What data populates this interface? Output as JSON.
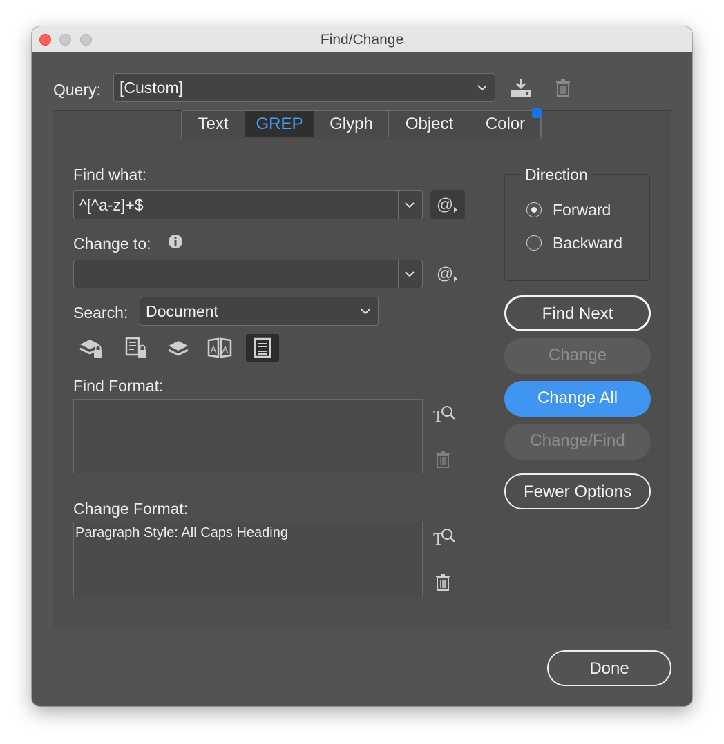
{
  "window": {
    "title": "Find/Change"
  },
  "query": {
    "label": "Query:",
    "value": "[Custom]"
  },
  "tabs": [
    {
      "label": "Text"
    },
    {
      "label": "GREP"
    },
    {
      "label": "Glyph"
    },
    {
      "label": "Object"
    },
    {
      "label": "Color"
    }
  ],
  "active_tab": "GREP",
  "find_what": {
    "label": "Find what:",
    "value": "^[^a-z]+$"
  },
  "change_to": {
    "label": "Change to:",
    "value": ""
  },
  "search": {
    "label": "Search:",
    "value": "Document"
  },
  "find_format": {
    "label": "Find Format:",
    "value": ""
  },
  "change_format": {
    "label": "Change Format:",
    "value": "Paragraph Style: All Caps Heading"
  },
  "direction": {
    "label": "Direction",
    "options": [
      {
        "label": "Forward",
        "selected": true
      },
      {
        "label": "Backward",
        "selected": false
      }
    ]
  },
  "buttons": {
    "find_next": "Find Next",
    "change": "Change",
    "change_all": "Change All",
    "change_find": "Change/Find",
    "fewer_options": "Fewer Options",
    "done": "Done"
  },
  "special_char_symbol": "@",
  "colors": {
    "accent": "#3f95f0",
    "active_tab_text": "#4b9cf2",
    "dialog_bg": "#535353"
  }
}
